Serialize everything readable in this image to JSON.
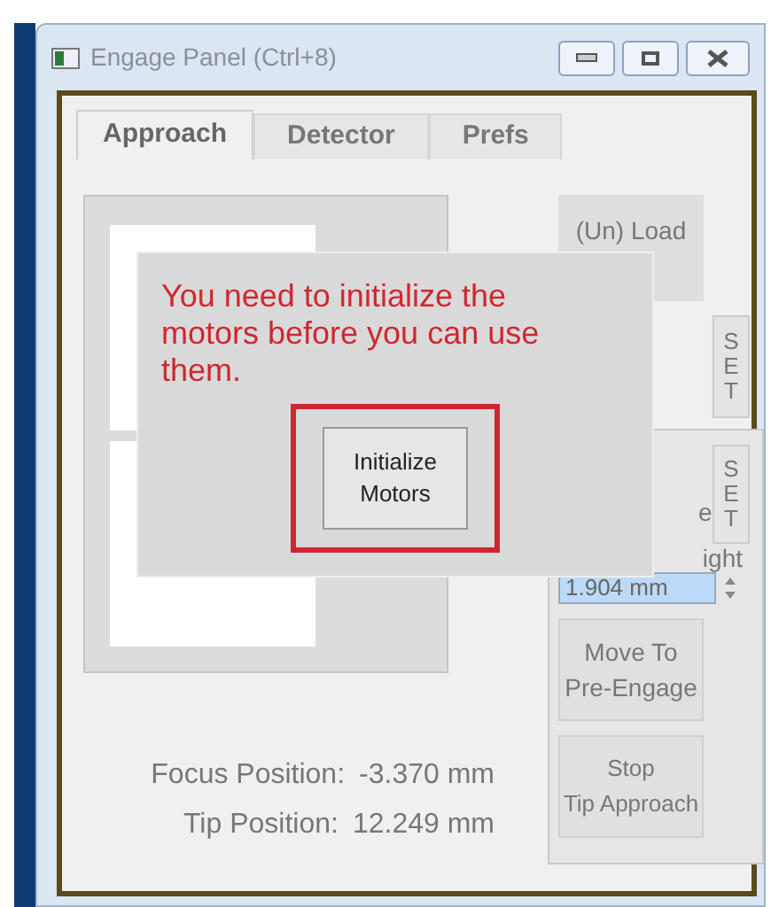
{
  "window": {
    "title": "Engage Panel (Ctrl+8)"
  },
  "tabs": [
    {
      "label": "Approach",
      "selected": true
    },
    {
      "label": "Detector",
      "selected": false
    },
    {
      "label": "Prefs",
      "selected": false
    }
  ],
  "load_button": "(Un) Load",
  "set_buttons": [
    "SET",
    "SET"
  ],
  "partial_label": "e",
  "spinner": {
    "label": "ight",
    "value": "1.904 mm"
  },
  "move_button": [
    "Move To",
    "Pre-Engage"
  ],
  "stop_button": [
    "Stop",
    "Tip Approach"
  ],
  "positions": [
    {
      "label": "Focus Position:",
      "value": "-3.370 mm"
    },
    {
      "label": "Tip Position:",
      "value": "12.249 mm"
    }
  ],
  "dialog": {
    "message": "You need to initialize the motors before you can use them.",
    "button": [
      "Initialize",
      "Motors"
    ],
    "highlighted": true
  }
}
